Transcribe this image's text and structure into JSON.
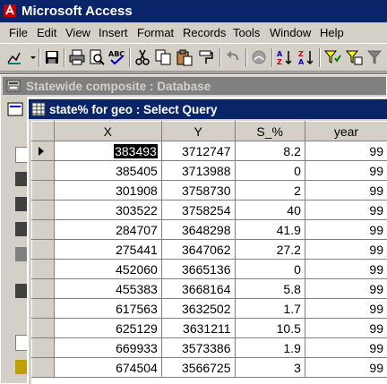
{
  "app": {
    "title": "Microsoft Access"
  },
  "menu": [
    "File",
    "Edit",
    "View",
    "Insert",
    "Format",
    "Records",
    "Tools",
    "Window",
    "Help"
  ],
  "toolbar": [
    "view-icon",
    "save-icon",
    "print-icon",
    "print-preview-icon",
    "spelling-icon",
    "cut-icon",
    "copy-icon",
    "paste-icon",
    "format-painter-icon",
    "undo-icon",
    "insert-hyperlink-icon",
    "sort-ascending-icon",
    "sort-descending-icon",
    "filter-by-selection-icon",
    "filter-by-form-icon",
    "apply-filter-icon"
  ],
  "database_window": {
    "title": "Statewide composite : Database"
  },
  "query_window": {
    "title": "state% for geo : Select Query",
    "columns": [
      "X",
      "Y",
      "S_%",
      "year"
    ],
    "rows": [
      [
        "383493",
        "3712747",
        "8.2",
        "99"
      ],
      [
        "385405",
        "3713988",
        "0",
        "99"
      ],
      [
        "301908",
        "3758730",
        "2",
        "99"
      ],
      [
        "303522",
        "3758254",
        "40",
        "99"
      ],
      [
        "284707",
        "3648298",
        "41.9",
        "99"
      ],
      [
        "275441",
        "3647062",
        "27.2",
        "99"
      ],
      [
        "452060",
        "3665136",
        "0",
        "99"
      ],
      [
        "455383",
        "3668164",
        "5.8",
        "99"
      ],
      [
        "617563",
        "3632502",
        "1.7",
        "99"
      ],
      [
        "625129",
        "3631211",
        "10.5",
        "99"
      ],
      [
        "669933",
        "3573386",
        "1.9",
        "99"
      ],
      [
        "674504",
        "3566725",
        "3",
        "99"
      ]
    ],
    "current_row": 0
  }
}
